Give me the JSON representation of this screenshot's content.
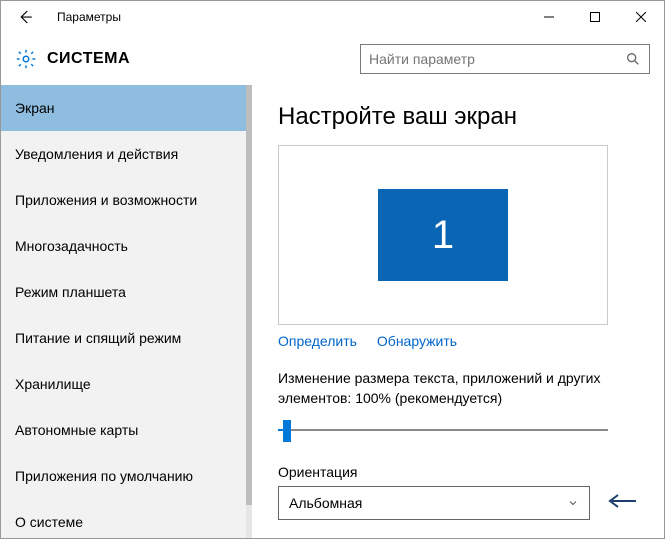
{
  "titlebar": {
    "title": "Параметры"
  },
  "header": {
    "section": "СИСТЕМА",
    "search_placeholder": "Найти параметр"
  },
  "sidebar": {
    "items": [
      {
        "label": "Экран",
        "selected": true
      },
      {
        "label": "Уведомления и действия",
        "selected": false
      },
      {
        "label": "Приложения и возможности",
        "selected": false
      },
      {
        "label": "Многозадачность",
        "selected": false
      },
      {
        "label": "Режим планшета",
        "selected": false
      },
      {
        "label": "Питание и спящий режим",
        "selected": false
      },
      {
        "label": "Хранилище",
        "selected": false
      },
      {
        "label": "Автономные карты",
        "selected": false
      },
      {
        "label": "Приложения по умолчанию",
        "selected": false
      },
      {
        "label": "О системе",
        "selected": false
      }
    ]
  },
  "content": {
    "page_title": "Настройте ваш экран",
    "monitor_number": "1",
    "identify_link": "Определить",
    "detect_link": "Обнаружить",
    "scale_text": "Изменение размера текста, приложений и других элементов: 100% (рекомендуется)",
    "orientation_label": "Ориентация",
    "orientation_value": "Альбомная"
  }
}
